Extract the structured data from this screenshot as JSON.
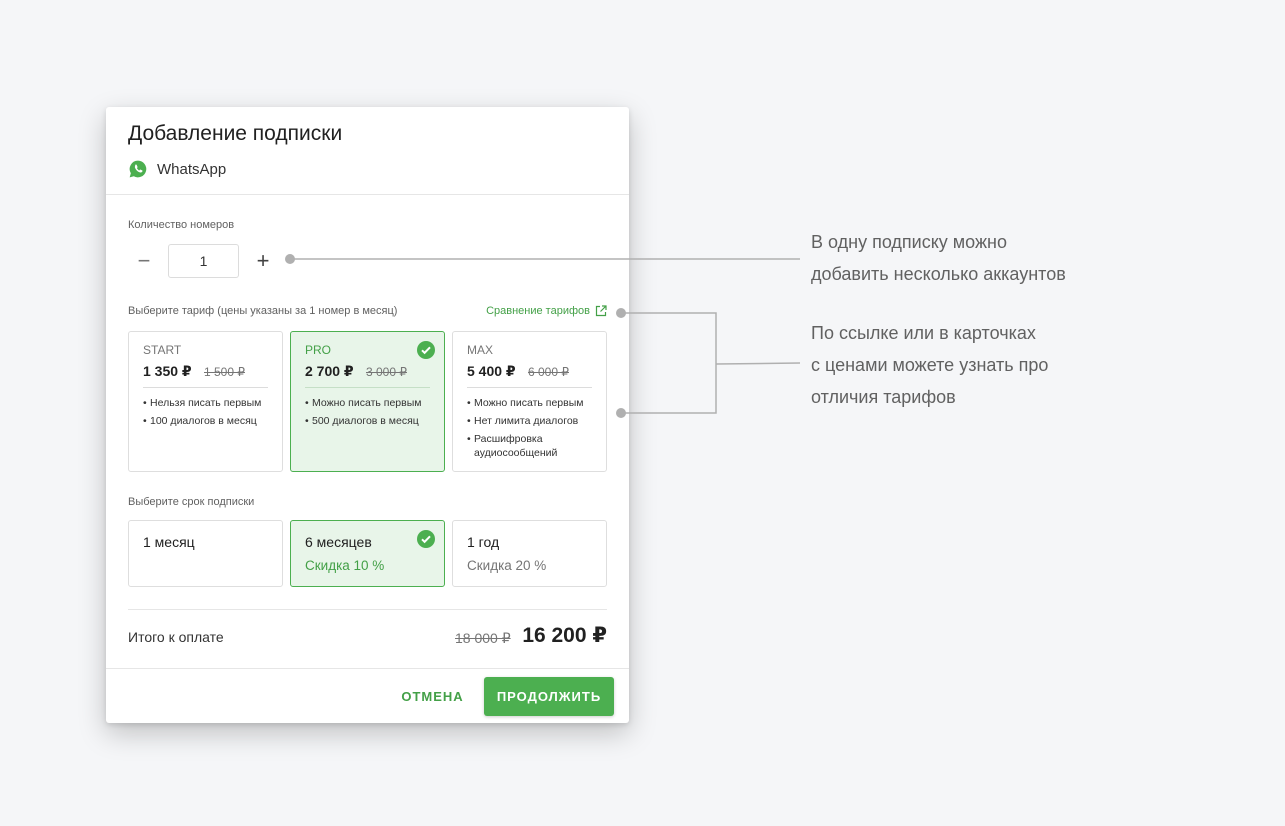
{
  "dialog": {
    "title": "Добавление подписки",
    "service_name": "WhatsApp",
    "quantity_label": "Количество номеров",
    "quantity_value": "1",
    "minus_symbol": "−",
    "plus_symbol": "+",
    "tariff_label": "Выберите тариф (цены указаны за 1 номер в месяц)",
    "compare_link": "Сравнение тарифов",
    "tariffs": [
      {
        "name": "START",
        "price": "1 350 ₽",
        "old_price": "1 500 ₽",
        "selected": false,
        "features": [
          "Нельзя писать первым",
          "100 диалогов в месяц"
        ]
      },
      {
        "name": "PRO",
        "price": "2 700 ₽",
        "old_price": "3 000 ₽",
        "selected": true,
        "features": [
          "Можно писать первым",
          "500 диалогов в месяц"
        ]
      },
      {
        "name": "MAX",
        "price": "5 400 ₽",
        "old_price": "6 000 ₽",
        "selected": false,
        "features": [
          "Можно писать первым",
          "Нет лимита диалогов",
          "Расшифровка аудиосообщений"
        ]
      }
    ],
    "period_label": "Выберите срок подписки",
    "periods": [
      {
        "name": "1 месяц",
        "discount": "",
        "selected": false
      },
      {
        "name": "6 месяцев",
        "discount": "Скидка 10 %",
        "selected": true
      },
      {
        "name": "1 год",
        "discount": "Скидка 20 %",
        "selected": false
      }
    ],
    "total_label": "Итого к оплате",
    "total_old": "18 000 ₽",
    "total_new": "16 200 ₽",
    "cancel_label": "ОТМЕНА",
    "continue_label": "ПРОДОЛЖИТЬ"
  },
  "annotations": {
    "accounts": [
      "В одну подписку можно",
      "добавить несколько аккаунтов"
    ],
    "tariffs": [
      "По ссылке или в карточках",
      "с ценами можете узнать про",
      "отличия тарифов"
    ]
  },
  "colors": {
    "accent": "#4caf50",
    "accent_text": "#43a047",
    "selected_bg": "#e8f5e9",
    "whatsapp": "#4caf50",
    "annotation_line": "#b0b0b0"
  },
  "icons": {
    "service": "whatsapp-icon",
    "check": "check-circle-icon",
    "external": "external-link-icon"
  }
}
